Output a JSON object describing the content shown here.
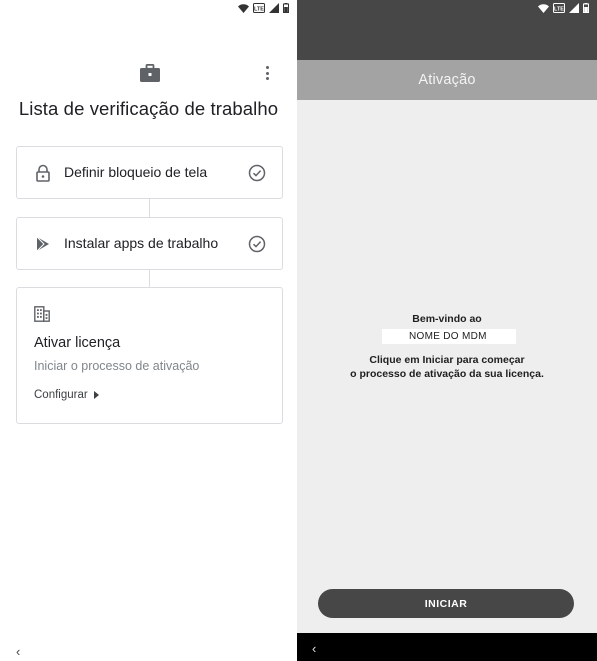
{
  "left_screen": {
    "status_bar": {
      "icons": [
        "wifi-icon",
        "lte-icon",
        "signal-icon",
        "battery-icon"
      ],
      "lte_text": "LTE"
    },
    "header": {
      "briefcase_icon": "briefcase-icon",
      "more_icon": "more-vert-icon"
    },
    "title": "Lista de verificação de trabalho",
    "checklist": [
      {
        "icon": "lock-icon",
        "label": "Definir bloqueio de tela",
        "status_icon": "check-circle-icon"
      },
      {
        "icon": "play-store-icon",
        "label": "Instalar apps de trabalho",
        "status_icon": "check-circle-icon"
      }
    ],
    "license_card": {
      "icon": "building-icon",
      "title": "Ativar licença",
      "subtitle": "Iniciar o processo de ativação",
      "action": "Configurar"
    },
    "nav": {
      "back": "‹"
    }
  },
  "right_screen": {
    "status_bar": {
      "icons": [
        "wifi-icon",
        "lte-icon",
        "signal-icon",
        "battery-icon"
      ],
      "lte_text": "LTE"
    },
    "header_title": "Ativação",
    "welcome": "Bem-vindo ao",
    "mdm_name": "NOME DO MDM",
    "instruction_line1": "Clique em Iniciar para começar",
    "instruction_line2": "o processo de ativação da sua licença.",
    "start_button": "INICIAR",
    "nav": {
      "back": "‹"
    }
  },
  "colors": {
    "dark_bar": "#474747",
    "header_gray": "#a3a3a3",
    "right_bg": "#eeeeee",
    "card_border": "#dadce0",
    "muted_text": "#80868b"
  }
}
